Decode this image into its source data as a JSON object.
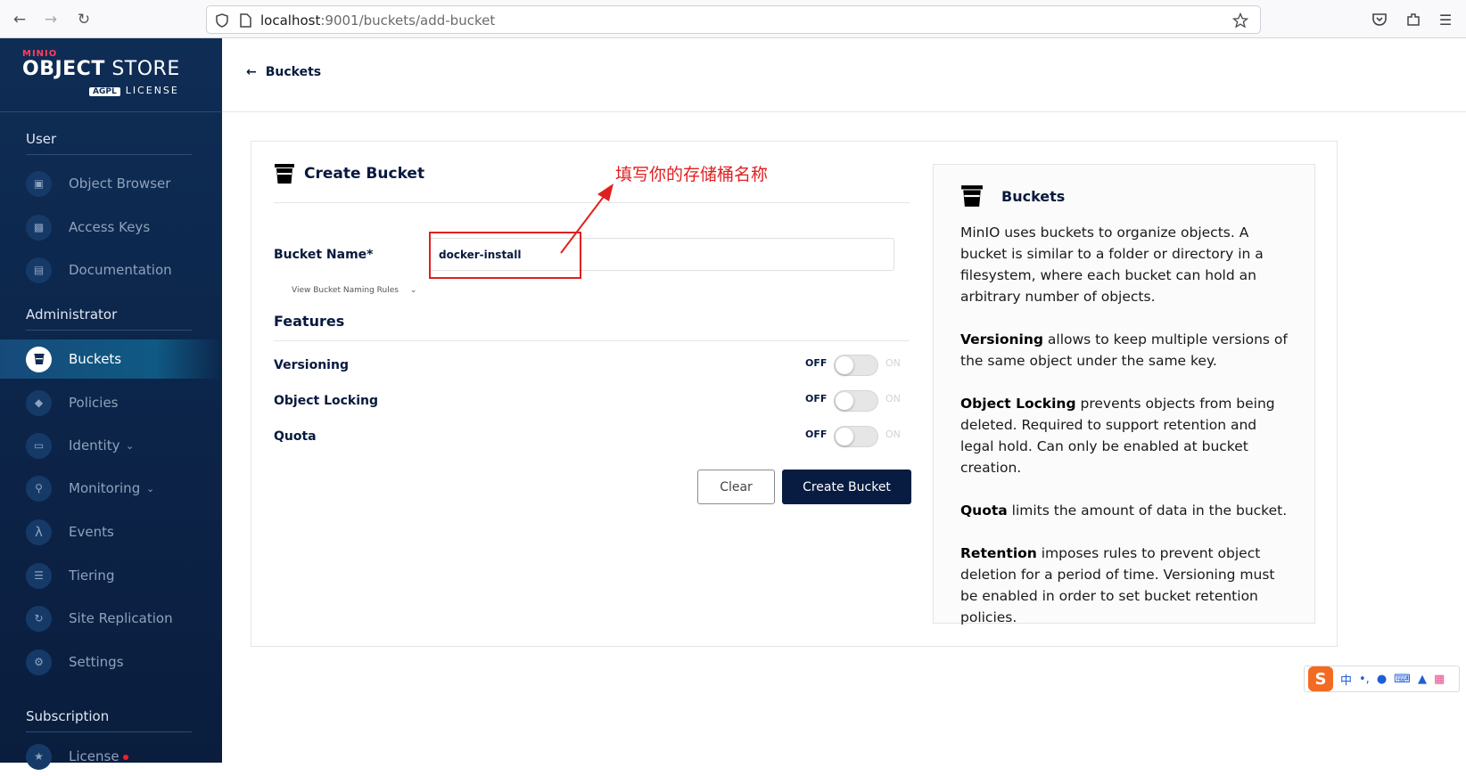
{
  "browser": {
    "url_host": "localhost",
    "url_rest": ":9001/buckets/add-bucket"
  },
  "sidebar": {
    "logo_brand": "MINIO",
    "logo_object": "OBJECT",
    "logo_store": " STORE",
    "logo_agpl": "AGPL",
    "logo_license": "LICENSE",
    "sections": {
      "user": "User",
      "admin": "Administrator",
      "subscription": "Subscription"
    },
    "items": {
      "object_browser": "Object Browser",
      "access_keys": "Access Keys",
      "documentation": "Documentation",
      "buckets": "Buckets",
      "policies": "Policies",
      "identity": "Identity",
      "monitoring": "Monitoring",
      "events": "Events",
      "tiering": "Tiering",
      "site_replication": "Site Replication",
      "settings": "Settings",
      "license": "License"
    }
  },
  "header": {
    "back_label": "Buckets"
  },
  "form": {
    "title": "Create Bucket",
    "bucket_name_label": "Bucket Name*",
    "bucket_name_value": "docker-install",
    "naming_rules": "View Bucket Naming Rules",
    "features_title": "Features",
    "features": {
      "versioning": "Versioning",
      "object_locking": "Object Locking",
      "quota": "Quota"
    },
    "toggle_off": "OFF",
    "toggle_on": "ON",
    "clear_button": "Clear",
    "create_button": "Create Bucket"
  },
  "annotation": {
    "text": "填写你的存储桶名称",
    "color": "#e02020"
  },
  "help": {
    "title": "Buckets",
    "intro": "MinIO uses buckets to organize objects. A bucket is similar to a folder or directory in a filesystem, where each bucket can hold an arbitrary number of objects.",
    "versioning_term": "Versioning",
    "versioning_text": " allows to keep multiple versions of the same object under the same key.",
    "locking_term": "Object Locking",
    "locking_text": " prevents objects from being deleted. Required to support retention and legal hold. Can only be enabled at bucket creation.",
    "quota_term": "Quota",
    "quota_text": " limits the amount of data in the bucket.",
    "retention_term": "Retention",
    "retention_text": " imposes rules to prevent object deletion for a period of time. Versioning must be enabled in order to set bucket retention policies."
  },
  "ime": {
    "logo": "S",
    "lang": "中"
  },
  "colors": {
    "sidebar_bg": "#0e2d55",
    "primary_button": "#081c42",
    "annotation_red": "#e02020"
  }
}
